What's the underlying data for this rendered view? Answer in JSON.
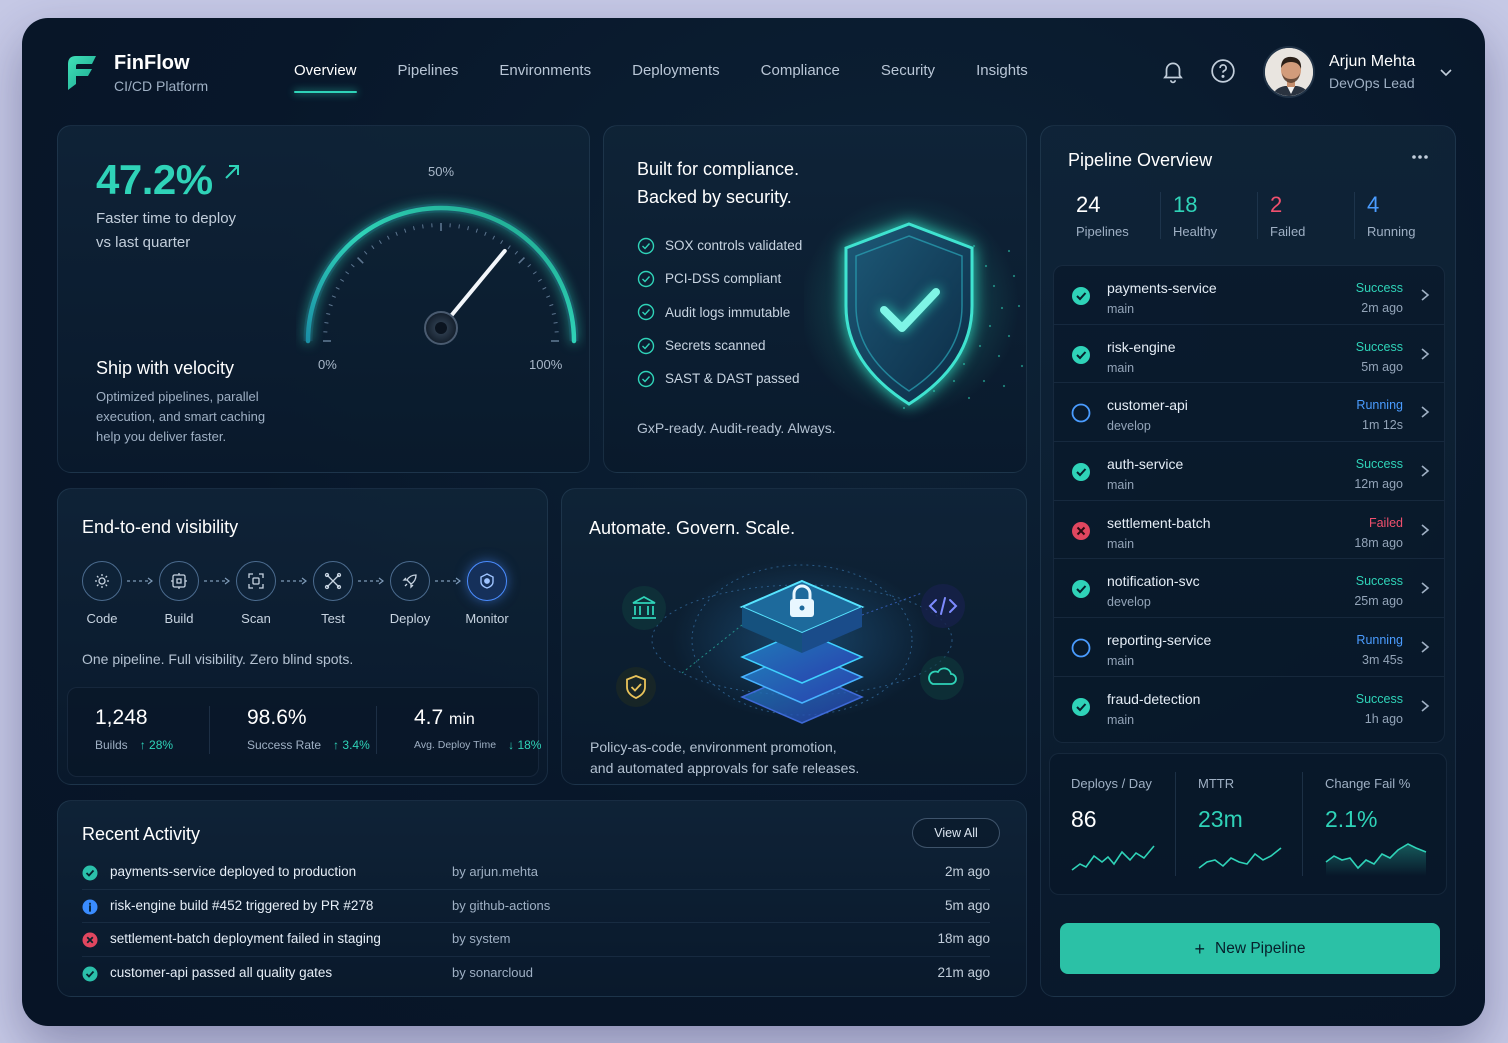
{
  "brand": {
    "name": "FinFlow",
    "subtitle": "CI/CD Platform"
  },
  "nav": {
    "items": [
      "Overview",
      "Pipelines",
      "Environments",
      "Deployments",
      "Compliance",
      "Security",
      "Insights"
    ],
    "active": "Overview"
  },
  "header_icons": [
    "bell-icon",
    "help-icon",
    "chevron-down-icon"
  ],
  "user": {
    "name": "Arjun Mehta",
    "role": "DevOps Lead"
  },
  "velocity": {
    "value": "47.2%",
    "desc_line1": "Faster time to deploy",
    "desc_line2": "vs last quarter",
    "title": "Ship with velocity",
    "body_line1": "Optimized pipelines, parallel",
    "body_line2": "execution, and smart caching",
    "body_line3": "help you deliver faster.",
    "gauge": {
      "label_min": "0%",
      "label_mid": "50%",
      "label_max": "100%",
      "value": 0.72
    }
  },
  "compliance": {
    "title_line1": "Built for compliance.",
    "title_line2": "Backed by security.",
    "checks": [
      "SOX controls validated",
      "PCI-DSS compliant",
      "Audit logs immutable",
      "Secrets scanned",
      "SAST & DAST passed"
    ],
    "footer": "GxP-ready. Audit-ready. Always."
  },
  "visibility": {
    "title": "End-to-end visibility",
    "steps": [
      {
        "label": "Code",
        "icon": "code-gear-icon"
      },
      {
        "label": "Build",
        "icon": "build-icon"
      },
      {
        "label": "Scan",
        "icon": "scan-icon"
      },
      {
        "label": "Test",
        "icon": "test-icon"
      },
      {
        "label": "Deploy",
        "icon": "rocket-icon"
      },
      {
        "label": "Monitor",
        "icon": "monitor-shield-icon"
      }
    ],
    "tagline": "One pipeline. Full visibility. Zero blind spots.",
    "stats": [
      {
        "value": "1,248",
        "unit": "",
        "label": "Builds",
        "delta": "28%",
        "dir": "up"
      },
      {
        "value": "98.6%",
        "unit": "",
        "label": "Success Rate",
        "delta": "3.4%",
        "dir": "up"
      },
      {
        "value": "4.7",
        "unit": "min",
        "label": "Avg. Deploy Time",
        "delta": "18%",
        "dir": "down"
      }
    ]
  },
  "automate": {
    "title": "Automate. Govern. Scale.",
    "body_line1": "Policy-as-code, environment promotion,",
    "body_line2": "and automated approvals for safe releases.",
    "icons": [
      "bank-icon",
      "shield-check-icon",
      "code-icon",
      "cloud-icon",
      "lock-stack-icon"
    ]
  },
  "activity": {
    "title": "Recent Activity",
    "view_all": "View All",
    "items": [
      {
        "status": "success",
        "text": "payments-service deployed to production",
        "by": "by arjun.mehta",
        "when": "2m ago"
      },
      {
        "status": "info",
        "text": "risk-engine build #452 triggered by PR #278",
        "by": "by github-actions",
        "when": "5m ago"
      },
      {
        "status": "failed",
        "text": "settlement-batch deployment failed in staging",
        "by": "by system",
        "when": "18m ago"
      },
      {
        "status": "success",
        "text": "customer-api passed all quality gates",
        "by": "by sonarcloud",
        "when": "21m ago"
      }
    ]
  },
  "pipeline": {
    "title": "Pipeline Overview",
    "stats": [
      {
        "value": "24",
        "label": "Pipelines",
        "color": "#ffffff"
      },
      {
        "value": "18",
        "label": "Healthy",
        "color": "#2fd3b8"
      },
      {
        "value": "2",
        "label": "Failed",
        "color": "#f0506e"
      },
      {
        "value": "4",
        "label": "Running",
        "color": "#4a9cff"
      }
    ],
    "rows": [
      {
        "name": "payments-service",
        "branch": "main",
        "status": "Success",
        "time": "2m ago"
      },
      {
        "name": "risk-engine",
        "branch": "main",
        "status": "Success",
        "time": "5m ago"
      },
      {
        "name": "customer-api",
        "branch": "develop",
        "status": "Running",
        "time": "1m 12s"
      },
      {
        "name": "auth-service",
        "branch": "main",
        "status": "Success",
        "time": "12m ago"
      },
      {
        "name": "settlement-batch",
        "branch": "main",
        "status": "Failed",
        "time": "18m ago"
      },
      {
        "name": "notification-svc",
        "branch": "develop",
        "status": "Success",
        "time": "25m ago"
      },
      {
        "name": "reporting-service",
        "branch": "main",
        "status": "Running",
        "time": "3m 45s"
      },
      {
        "name": "fraud-detection",
        "branch": "main",
        "status": "Success",
        "time": "1h ago"
      }
    ],
    "metrics": [
      {
        "label": "Deploys / Day",
        "value": "86"
      },
      {
        "label": "MTTR",
        "value": "23m"
      },
      {
        "label": "Change Fail %",
        "value": "2.1%"
      }
    ],
    "new_button": "New Pipeline"
  },
  "colors": {
    "accent": "#2fd3b8",
    "running": "#4a9cff",
    "failed": "#f0506e",
    "background": "#08172a"
  }
}
